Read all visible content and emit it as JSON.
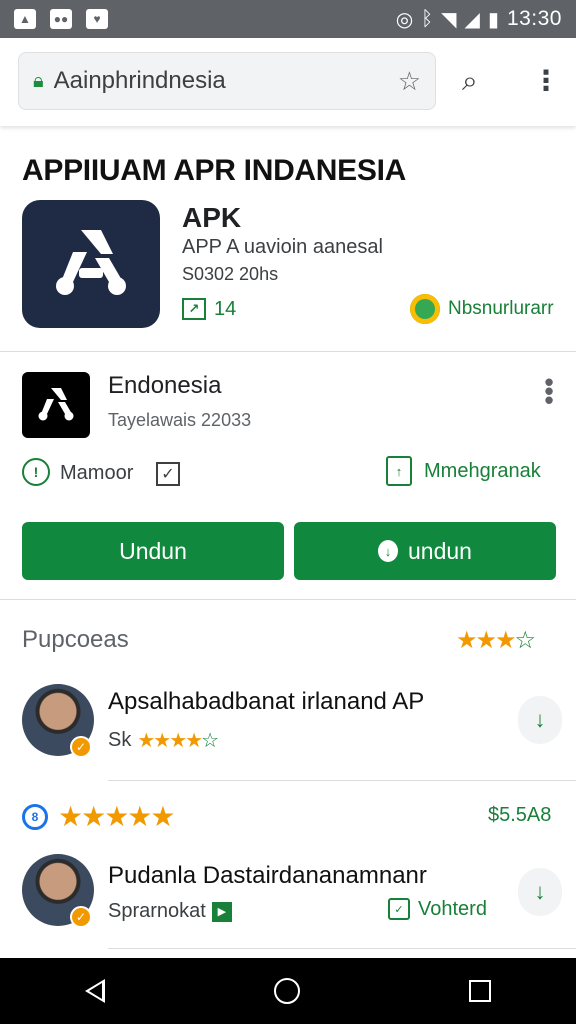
{
  "status_bar": {
    "time": "13:30",
    "left_icons": [
      "image-icon",
      "media-icon",
      "notification-icon"
    ],
    "right_icons": [
      "vibrate-icon",
      "bluetooth-icon",
      "wifi-icon",
      "signal-icon",
      "battery-icon"
    ]
  },
  "browser": {
    "url": "Aainphrindnesia",
    "lock_icon": "lock-icon",
    "bookmark_icon": "star-icon",
    "search_icon": "search-icon",
    "menu_icon": "more-vert-icon"
  },
  "header": {
    "page_title": "APPIIUAM APR INDANESIA",
    "app_name": "APK",
    "app_subtitle": "APP A uavioin aanesal",
    "app_size": "S0302 20hs",
    "rating_count": "14",
    "developer": "Nbsnurlurarr"
  },
  "detail": {
    "title": "Endonesia",
    "subtitle": "Tayelawais 22033",
    "maintain_label": "Mamoor",
    "share_label": "Mmehgranak",
    "button_primary": "Undun",
    "button_secondary": "undun"
  },
  "reviews": {
    "header": "Pupcoeas",
    "header_stars": "★★★☆",
    "items": [
      {
        "title": "Apsalhabadbanat irlanand AP",
        "sub_label": "Sk",
        "stars": "★★★★☆"
      },
      {
        "title": "Pudanla Dastairdananamnanr",
        "sub_label": "Sprarnokat",
        "verified_label": "Vohterd"
      }
    ],
    "rating_row": {
      "stars": "★★★★★",
      "price": "$5.5A8"
    }
  },
  "colors": {
    "accent_green": "#10893e",
    "star_orange": "#f29900",
    "status_bar": "#5f6368",
    "app_icon_bg": "#1f2a44"
  }
}
